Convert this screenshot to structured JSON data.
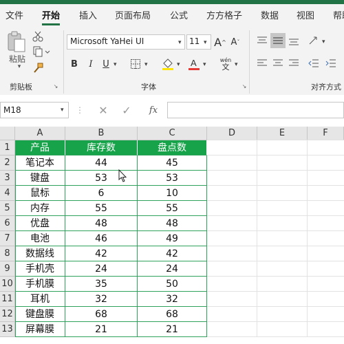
{
  "tabs": [
    "文件",
    "开始",
    "插入",
    "页面布局",
    "公式",
    "方方格子",
    "数据",
    "视图",
    "帮助"
  ],
  "active_tab": "开始",
  "clipboard": {
    "paste_label": "粘贴",
    "group_label": "剪贴板"
  },
  "font": {
    "name": "Microsoft YaHei UI",
    "size": "11",
    "group_label": "字体",
    "bold": "B",
    "italic": "I",
    "underline": "U",
    "wen": "wén",
    "wen_char": "文",
    "grow": "A",
    "shrink": "A"
  },
  "align": {
    "group_label": "对齐方式"
  },
  "formula_bar": {
    "name_box": "M18",
    "fx": "fx"
  },
  "columns": [
    "A",
    "B",
    "C",
    "D",
    "E",
    "F"
  ],
  "rows": [
    "1",
    "2",
    "3",
    "4",
    "5",
    "6",
    "7",
    "8",
    "9",
    "10",
    "11",
    "12",
    "13"
  ],
  "table": {
    "headers": [
      "产品",
      "库存数",
      "盘点数"
    ],
    "rows": [
      [
        "笔记本",
        "44",
        "45"
      ],
      [
        "键盘",
        "53",
        "53"
      ],
      [
        "鼠标",
        "6",
        "10"
      ],
      [
        "内存",
        "55",
        "55"
      ],
      [
        "优盘",
        "48",
        "48"
      ],
      [
        "电池",
        "46",
        "49"
      ],
      [
        "数据线",
        "42",
        "42"
      ],
      [
        "手机壳",
        "24",
        "24"
      ],
      [
        "手机膜",
        "35",
        "50"
      ],
      [
        "耳机",
        "32",
        "32"
      ],
      [
        "键盘膜",
        "68",
        "68"
      ],
      [
        "屏幕膜",
        "21",
        "21"
      ]
    ]
  },
  "colors": {
    "accent": "#217346",
    "header_fill": "#16a34a",
    "table_border": "#2ea25a"
  }
}
